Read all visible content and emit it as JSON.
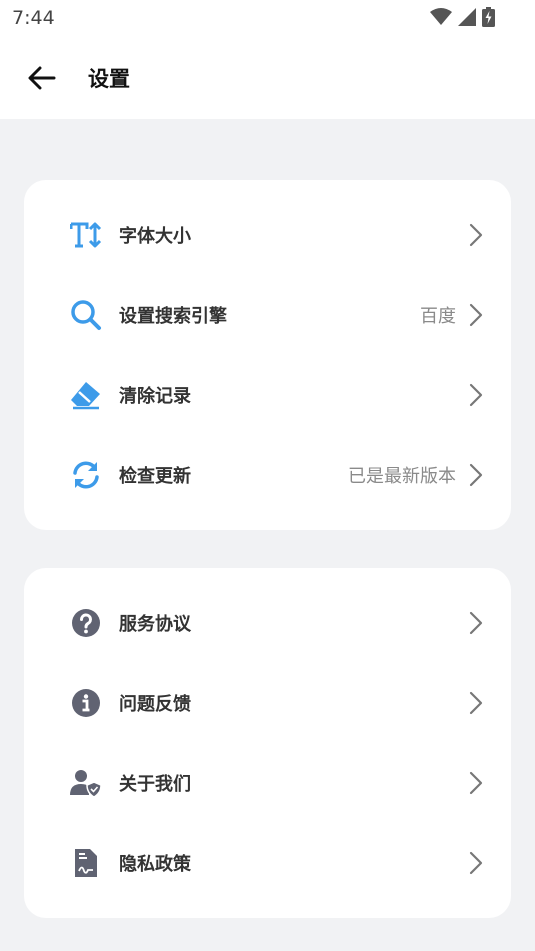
{
  "status_bar": {
    "time": "7:44"
  },
  "header": {
    "title": "设置"
  },
  "section1": {
    "items": [
      {
        "label": "字体大小",
        "value": ""
      },
      {
        "label": "设置搜索引擎",
        "value": "百度"
      },
      {
        "label": "清除记录",
        "value": ""
      },
      {
        "label": "检查更新",
        "value": "已是最新版本"
      }
    ]
  },
  "section2": {
    "items": [
      {
        "label": "服务协议"
      },
      {
        "label": "问题反馈"
      },
      {
        "label": "关于我们"
      },
      {
        "label": "隐私政策"
      }
    ]
  },
  "colors": {
    "accent_blue": "#3d9be9",
    "icon_gray": "#606372",
    "background": "#f1f2f4"
  }
}
